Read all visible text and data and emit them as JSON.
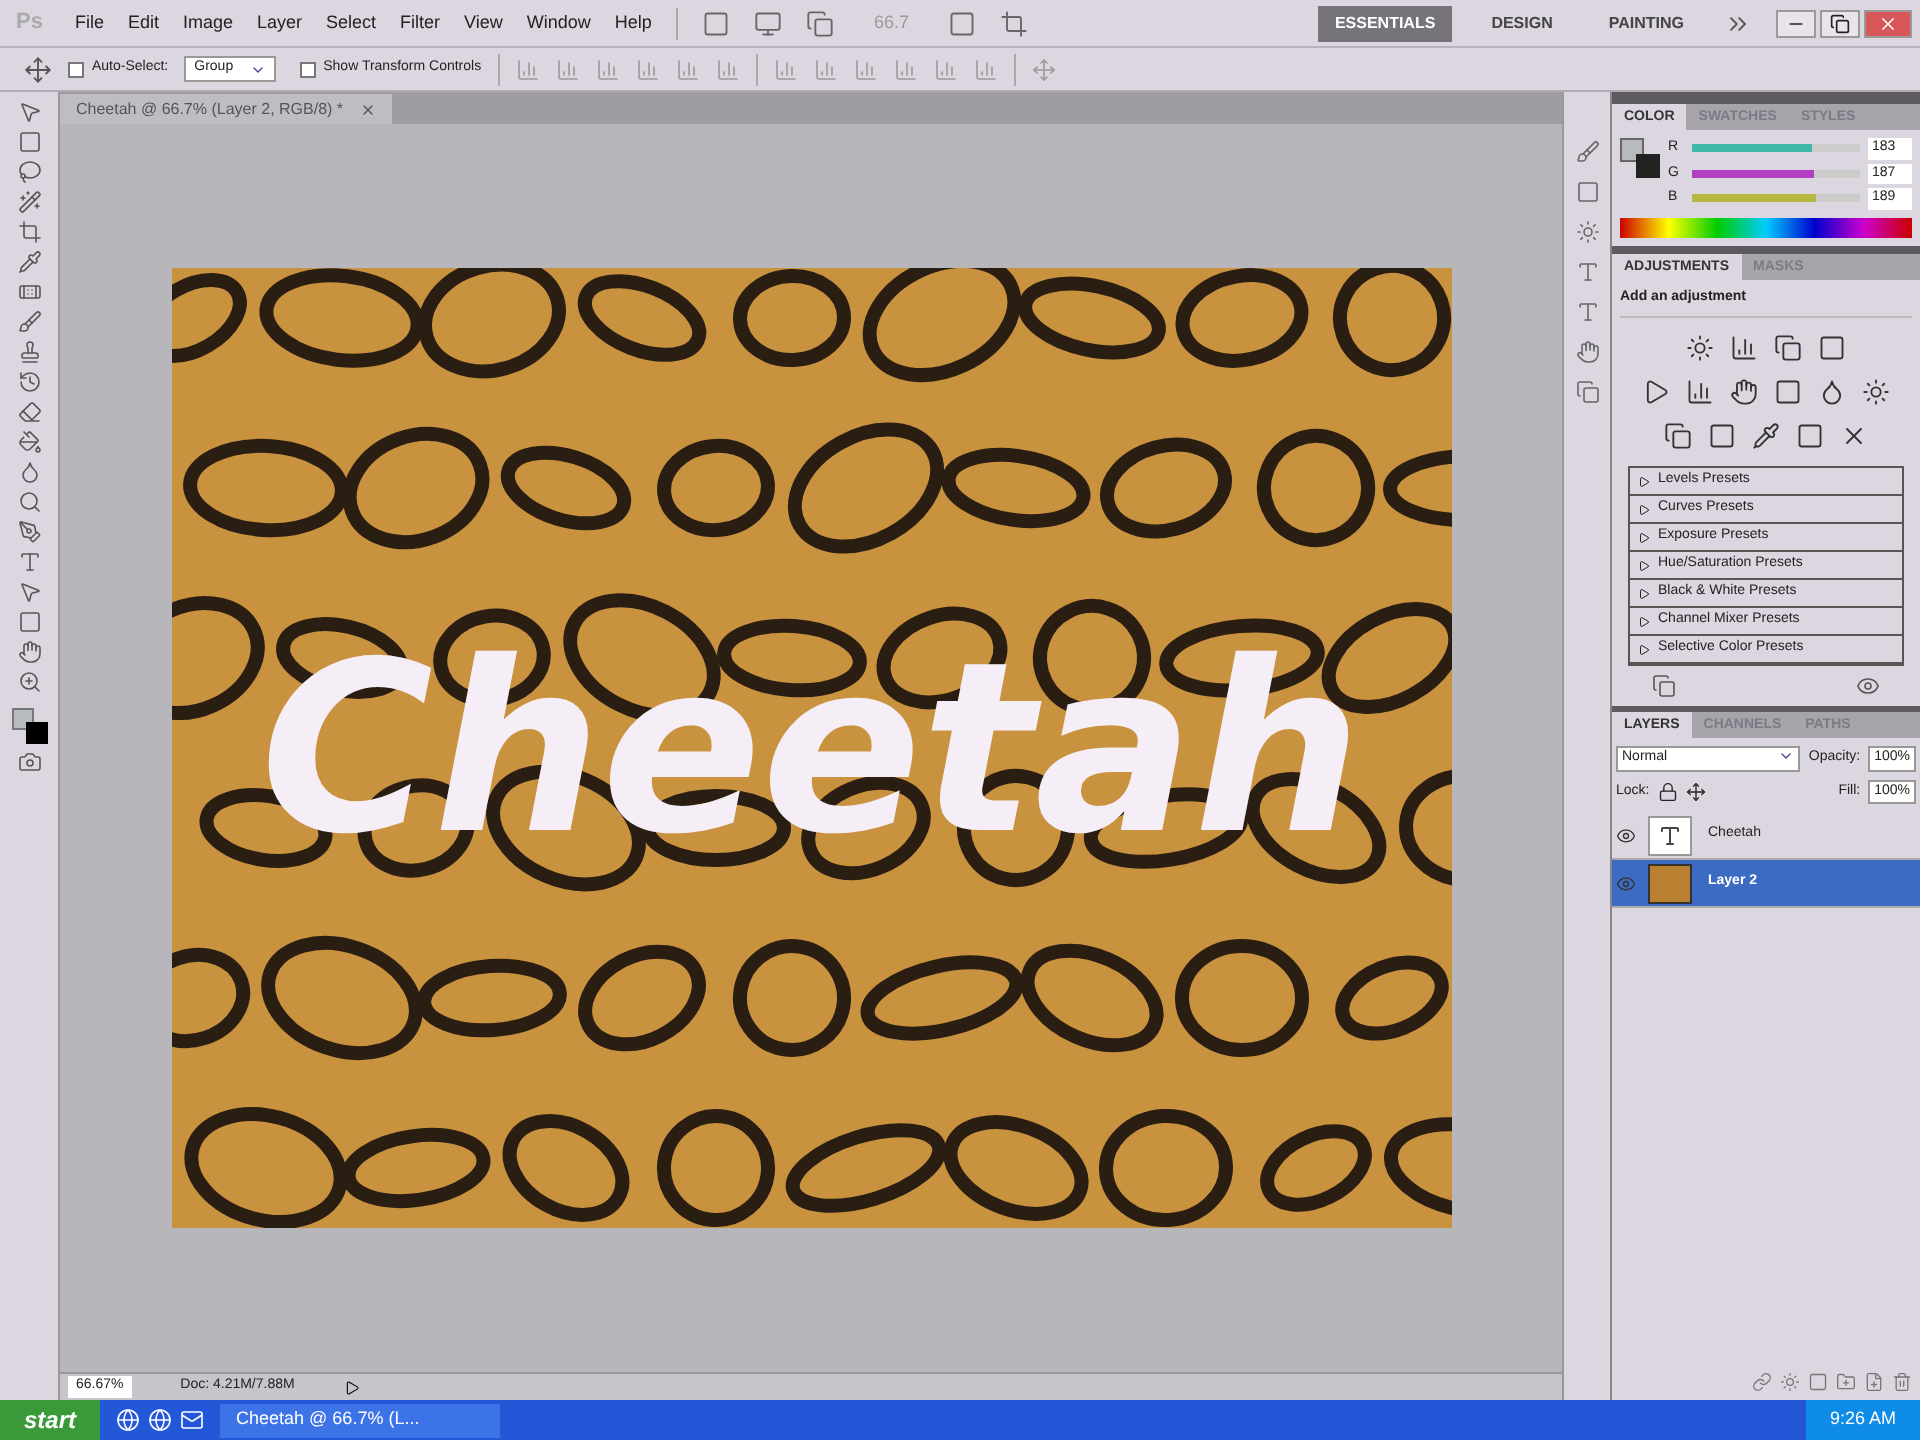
{
  "app": {
    "logo": "Ps"
  },
  "menu": [
    "File",
    "Edit",
    "Image",
    "Layer",
    "Select",
    "Filter",
    "View",
    "Window",
    "Help"
  ],
  "zoom_field": "66.7",
  "workspaces": [
    {
      "label": "ESSENTIALS",
      "selected": true
    },
    {
      "label": "DESIGN",
      "selected": false
    },
    {
      "label": "PAINTING",
      "selected": false
    }
  ],
  "options": {
    "auto_select": {
      "label": "Auto-Select:",
      "checked": false
    },
    "group": "Group",
    "transform": {
      "label": "Show Transform Controls",
      "checked": false
    }
  },
  "document_tab": {
    "title": "Cheetah @ 66.7% (Layer 2, RGB/8) *"
  },
  "canvas": {
    "text": "Cheetah"
  },
  "color_panel": {
    "tabs": [
      {
        "label": "COLOR",
        "selected": true
      },
      {
        "label": "SWATCHES",
        "selected": false
      },
      {
        "label": "STYLES",
        "selected": false
      }
    ],
    "channels": [
      {
        "name": "R",
        "value": "183",
        "level": 0.72,
        "color": "#3fb8a8"
      },
      {
        "name": "G",
        "value": "187",
        "level": 0.73,
        "color": "#b040c0"
      },
      {
        "name": "B",
        "value": "189",
        "level": 0.74,
        "color": "#b8b840"
      }
    ]
  },
  "adjustments_panel": {
    "tabs": [
      {
        "label": "ADJUSTMENTS",
        "selected": true
      },
      {
        "label": "MASKS",
        "selected": false
      }
    ],
    "heading": "Add an adjustment",
    "presets": [
      "Levels Presets",
      "Curves Presets",
      "Exposure Presets",
      "Hue/Saturation Presets",
      "Black & White Presets",
      "Channel Mixer Presets",
      "Selective Color Presets"
    ]
  },
  "layers_panel": {
    "tabs": [
      {
        "label": "LAYERS",
        "selected": true
      },
      {
        "label": "CHANNELS",
        "selected": false
      },
      {
        "label": "PATHS",
        "selected": false
      }
    ],
    "blend_mode": "Normal",
    "opacity_label": "Opacity:",
    "opacity": "100%",
    "lock_label": "Lock:",
    "fill_label": "Fill:",
    "fill": "100%",
    "layers": [
      {
        "name": "Cheetah",
        "kind": "text",
        "visible": true,
        "selected": false
      },
      {
        "name": "Layer 2",
        "kind": "image",
        "visible": true,
        "selected": true
      }
    ]
  },
  "status_bar": {
    "zoom": "66.67%",
    "doc": "Doc: 4.21M/7.88M"
  },
  "taskbar": {
    "start": "start",
    "tasks": [
      {
        "label": "Cheetah @ 66.7% (L..."
      }
    ],
    "clock": "9:26 AM"
  }
}
